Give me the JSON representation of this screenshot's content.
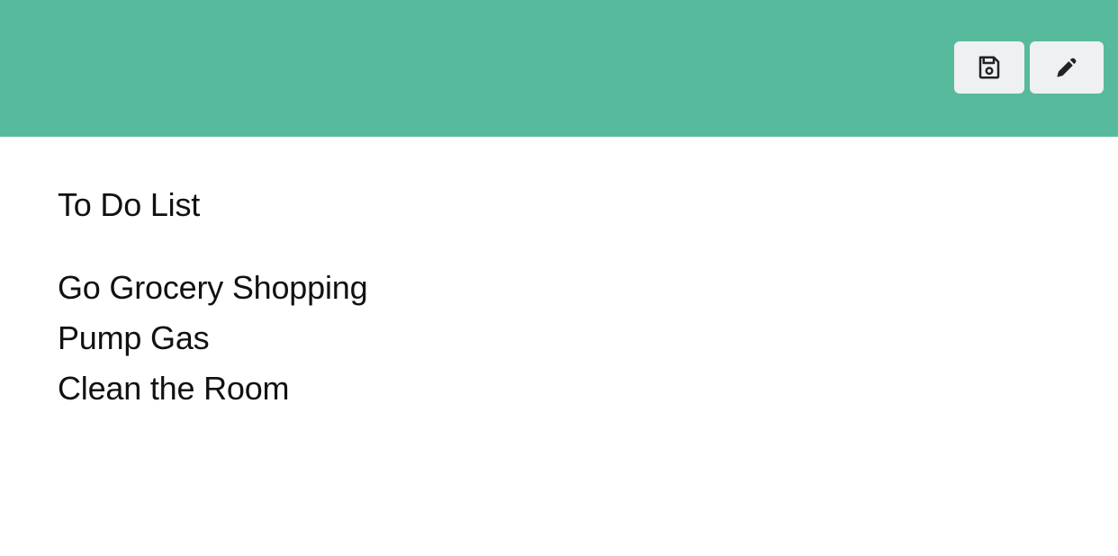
{
  "header": {
    "background_color": "#57ba9d",
    "buttons": [
      {
        "icon": "save-icon",
        "label": ""
      },
      {
        "icon": "pencil-icon",
        "label": ""
      }
    ]
  },
  "main": {
    "title": "To Do List",
    "items": [
      "Go Grocery Shopping",
      "Pump Gas",
      "Clean the Room"
    ]
  }
}
